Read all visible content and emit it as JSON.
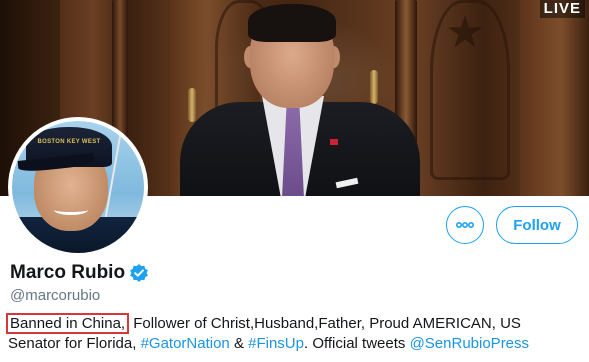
{
  "banner": {
    "live_label": "LIVE"
  },
  "avatar": {
    "cap_text": "BOSTON KEY WEST"
  },
  "actions": {
    "more_icon": "more-dots-icon",
    "follow_label": "Follow"
  },
  "profile": {
    "display_name": "Marco Rubio",
    "verified_icon": "verified-badge-icon",
    "handle": "@marcorubio"
  },
  "bio": {
    "highlighted": "Banned in China,",
    "line1_rest": " Follower of Christ,Husband,Father, Proud AMERICAN, US",
    "line2_prefix": "Senator for Florida, ",
    "hashtag1": "#GatorNation",
    "line2_mid": " & ",
    "hashtag2": "#FinsUp",
    "line2_mid2": ". Official tweets ",
    "mention": "@SenRubioPress"
  },
  "colors": {
    "accent": "#1da1f2",
    "link": "#1b95e0",
    "highlight_box": "#d8373a",
    "text": "#14171a",
    "muted": "#657786"
  }
}
